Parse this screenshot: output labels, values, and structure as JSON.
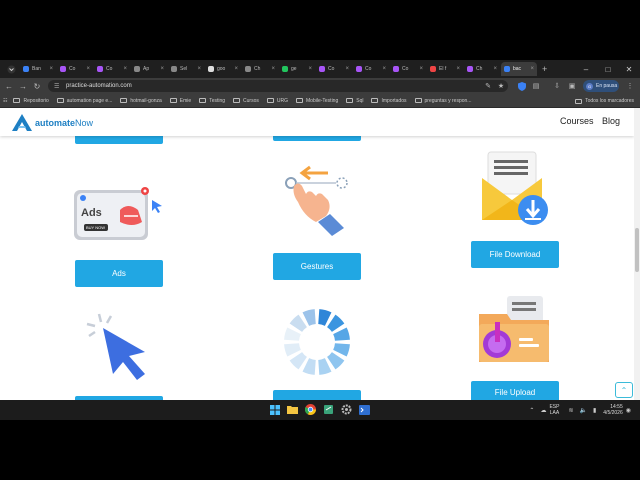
{
  "browser": {
    "tabs": [
      {
        "label": "Ban",
        "color": "#3b82f6"
      },
      {
        "label": "Co",
        "color": "#a855f7"
      },
      {
        "label": "Co",
        "color": "#a855f7"
      },
      {
        "label": "Ap",
        "color": "#888888"
      },
      {
        "label": "Sel",
        "color": "#888888"
      },
      {
        "label": "goo",
        "color": "#dddddd"
      },
      {
        "label": "Ch",
        "color": "#888888"
      },
      {
        "label": "ge",
        "color": "#22c55e"
      },
      {
        "label": "Co",
        "color": "#a855f7"
      },
      {
        "label": "Co",
        "color": "#a855f7"
      },
      {
        "label": "Co",
        "color": "#a855f7"
      },
      {
        "label": "El f",
        "color": "#ef4444"
      },
      {
        "label": "Ch",
        "color": "#a855f7"
      },
      {
        "label": "bac",
        "color": "#3b82f6"
      }
    ],
    "active_tab_index": 13,
    "url": "practice-automation.com",
    "profile_status": "En pausa",
    "profile_initial": "G",
    "bookmarks": [
      "Repositorio",
      "automation page e...",
      "hotmail-gonza",
      "Emie",
      "Testing",
      "Cursos",
      "URG",
      "Mobile-Testing",
      "Sql",
      "Importados",
      "preguntas y respon..."
    ],
    "all_bookmarks_label": "Todos los marcadores"
  },
  "site": {
    "logo_text_bold": "automate",
    "logo_text_light": "Now",
    "nav": [
      "Courses",
      "Blog"
    ],
    "cards": {
      "ads": {
        "label": "Ads",
        "badge_text": "Ads",
        "badge_sub": "BUY NOW"
      },
      "gestures": {
        "label": "Gestures"
      },
      "file_download": {
        "label": "File Download"
      },
      "file_upload": {
        "label": "File Upload"
      }
    },
    "accent_color": "#21a7e3"
  },
  "taskbar": {
    "language": [
      "ESP",
      "LAA"
    ],
    "time": "14:55",
    "date": "4/5/2026"
  }
}
